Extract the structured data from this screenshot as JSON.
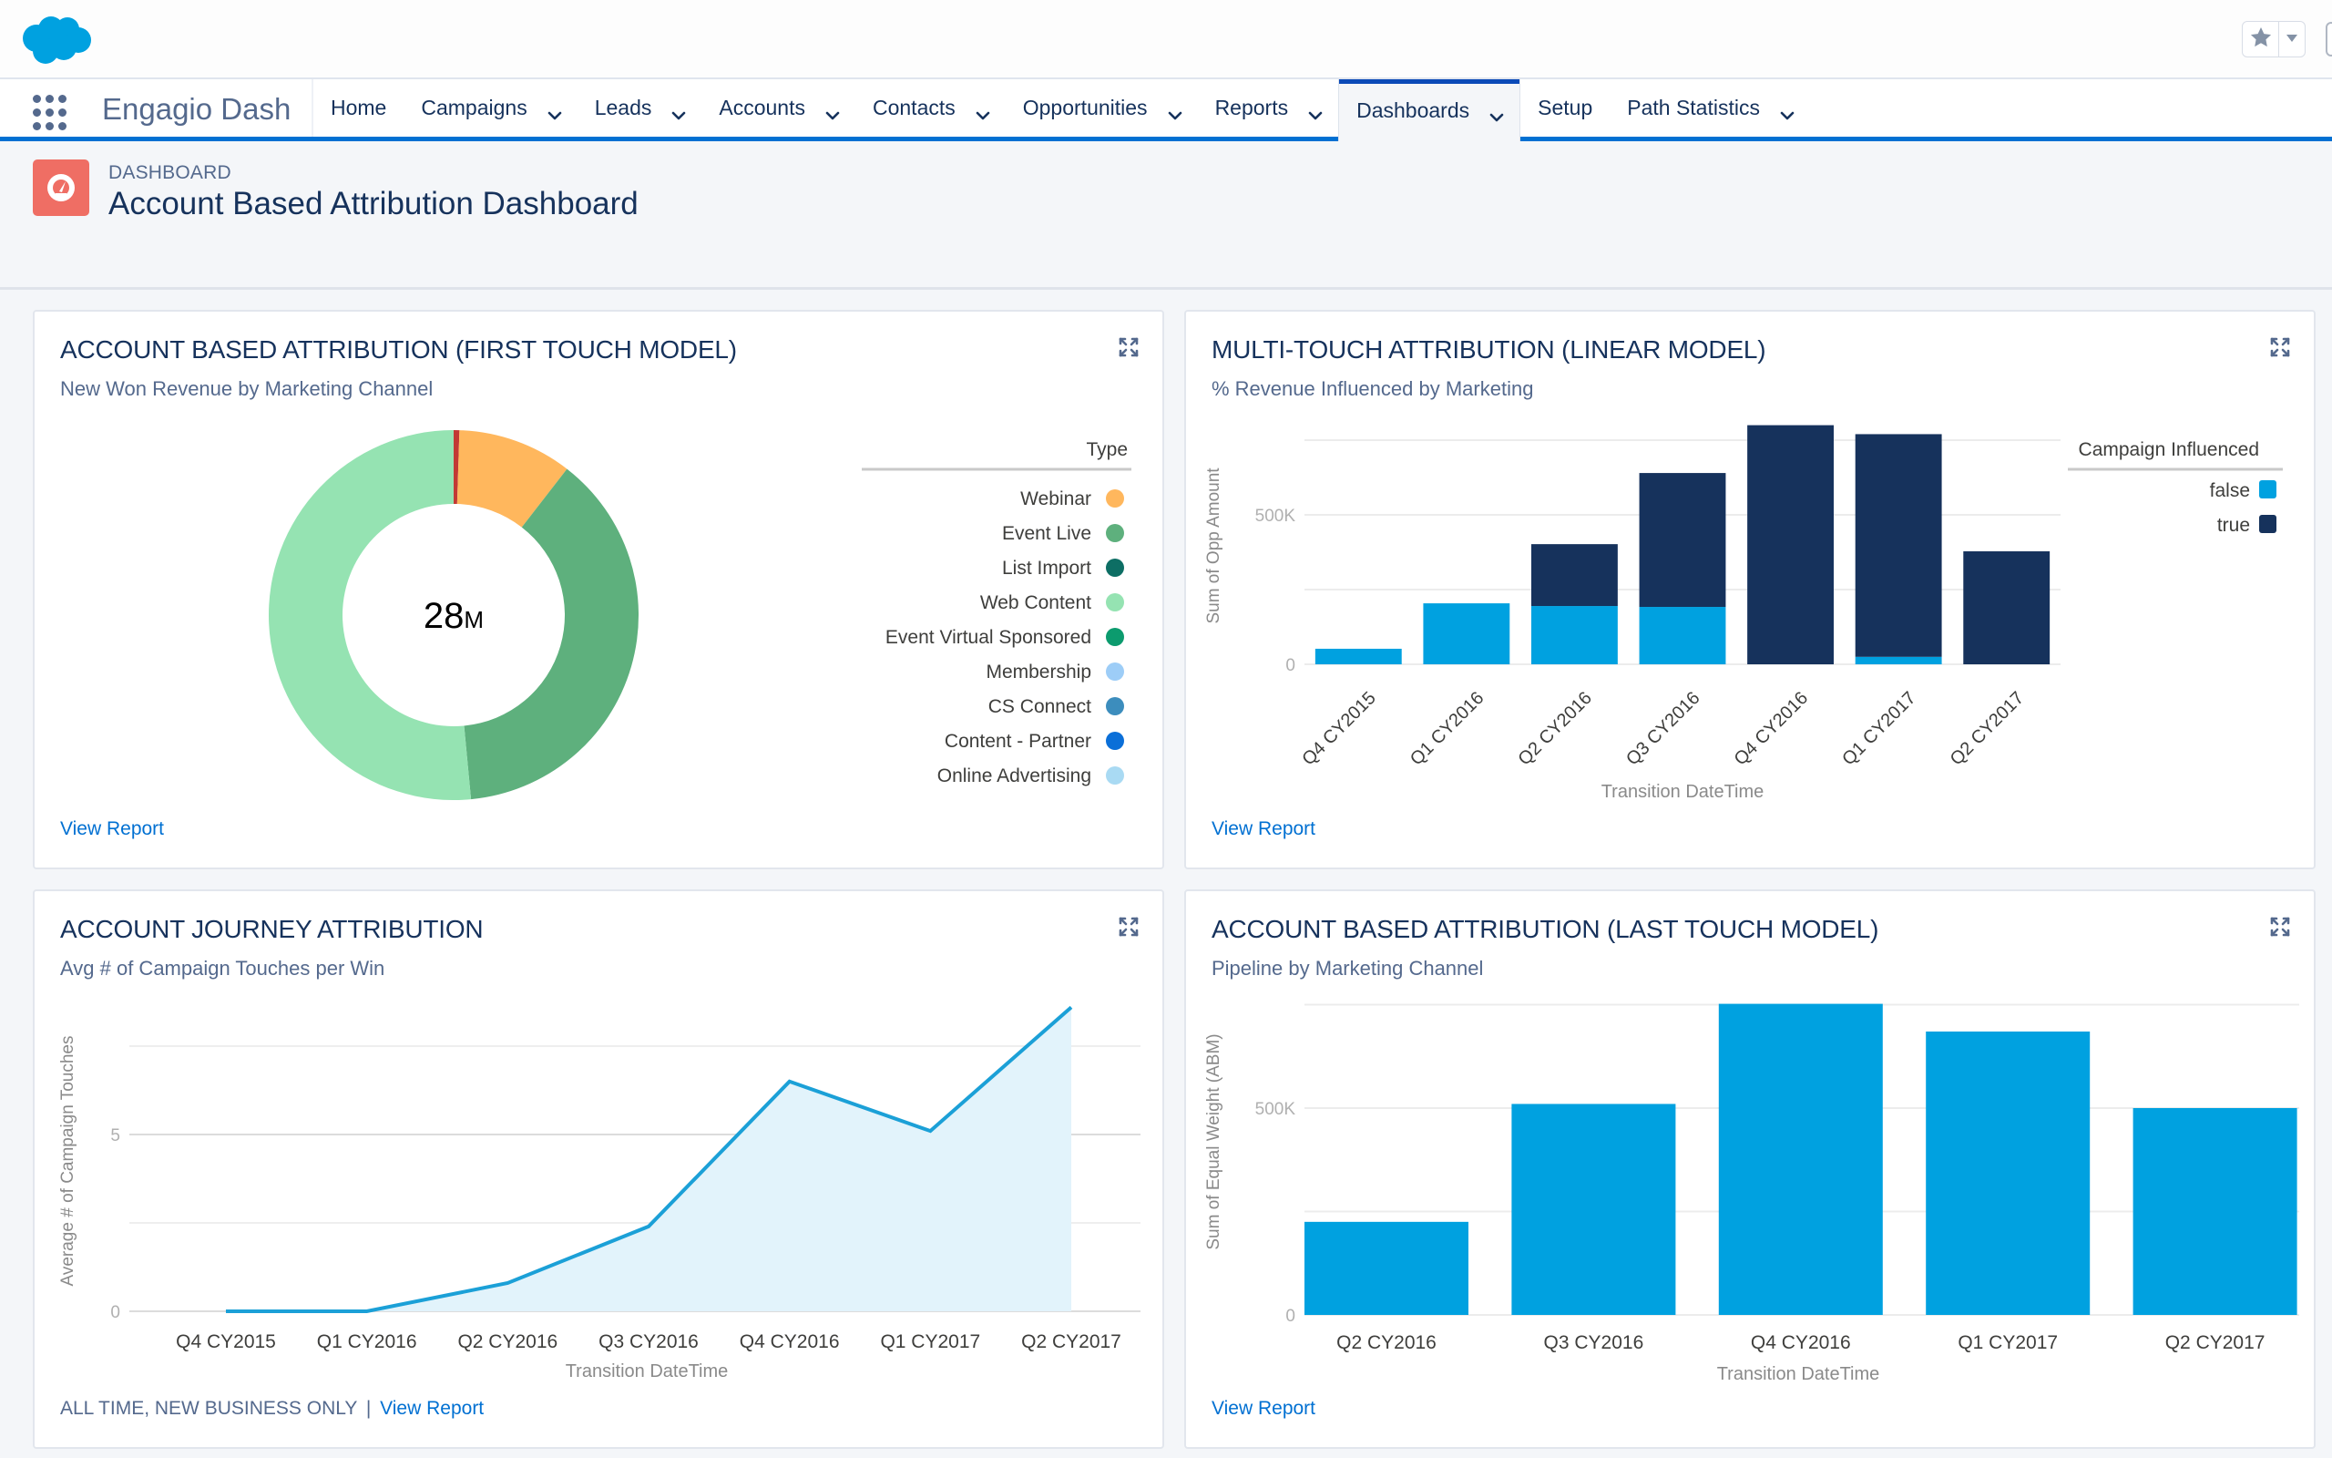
{
  "header": {
    "logo_icon": "salesforce-cloud-logo",
    "favorites_icon": "star-icon",
    "favorites_menu_icon": "caret-down-icon"
  },
  "nav": {
    "launcher_icon": "app-launcher-grid-icon",
    "app_name": "Engagio Dash",
    "items": [
      {
        "label": "Home",
        "has_menu": false,
        "active": false
      },
      {
        "label": "Campaigns",
        "has_menu": true,
        "active": false
      },
      {
        "label": "Leads",
        "has_menu": true,
        "active": false
      },
      {
        "label": "Accounts",
        "has_menu": true,
        "active": false
      },
      {
        "label": "Contacts",
        "has_menu": true,
        "active": false
      },
      {
        "label": "Opportunities",
        "has_menu": true,
        "active": false
      },
      {
        "label": "Reports",
        "has_menu": true,
        "active": false
      },
      {
        "label": "Dashboards",
        "has_menu": true,
        "active": true
      },
      {
        "label": "Setup",
        "has_menu": false,
        "active": false
      },
      {
        "label": "Path Statistics",
        "has_menu": true,
        "active": false
      }
    ]
  },
  "page": {
    "icon": "dashboard-gauge-icon",
    "type_label": "DASHBOARD",
    "title": "Account Based Attribution Dashboard"
  },
  "colors": {
    "brand_blue": "#0070d2",
    "bar_false": "#00a1e0",
    "bar_true": "#16325c",
    "line": "#1ba0d7",
    "line_fill": "#e2f3fb",
    "page_icon": "#ef6e64"
  },
  "cards": {
    "first_touch": {
      "title": "ACCOUNT BASED ATTRIBUTION (FIRST TOUCH MODEL)",
      "subtitle": "New Won Revenue by Marketing Channel",
      "footer_link": "View Report",
      "center_label": "28",
      "center_unit": "M",
      "legend_title": "Type"
    },
    "multi_touch": {
      "title": "MULTI-TOUCH ATTRIBUTION (LINEAR MODEL)",
      "subtitle": "% Revenue Influenced by Marketing",
      "footer_link": "View Report",
      "legend_title": "Campaign Influenced"
    },
    "journey": {
      "title": "ACCOUNT JOURNEY ATTRIBUTION",
      "subtitle": "Avg # of Campaign Touches per Win",
      "footer_text": "ALL TIME, NEW BUSINESS ONLY",
      "footer_sep": "|",
      "footer_link": "View Report"
    },
    "last_touch": {
      "title": "ACCOUNT BASED ATTRIBUTION (LAST TOUCH MODEL)",
      "subtitle": "Pipeline by Marketing Channel",
      "footer_link": "View Report"
    }
  },
  "chart_data": [
    {
      "id": "first_touch",
      "type": "pie",
      "variant": "donut",
      "title": "New Won Revenue by Marketing Channel",
      "total_label": "28M",
      "legend_title": "Type",
      "legend_position": "right",
      "legend": [
        {
          "label": "Webinar",
          "color": "#ffb75d"
        },
        {
          "label": "Event Live",
          "color": "#5eb07d"
        },
        {
          "label": "List Import",
          "color": "#0d6e64"
        },
        {
          "label": "Web Content",
          "color": "#95e3b2"
        },
        {
          "label": "Event Virtual Sponsored",
          "color": "#0c9b6e"
        },
        {
          "label": "Membership",
          "color": "#9dcdf7"
        },
        {
          "label": "CS Connect",
          "color": "#3c8dbd"
        },
        {
          "label": "Content - Partner",
          "color": "#0b6fd8"
        },
        {
          "label": "Online Advertising",
          "color": "#a9daf3"
        }
      ],
      "slices": [
        {
          "label": "(unlabeled)",
          "value_pct": 0.5,
          "color": "#c23934"
        },
        {
          "label": "Webinar",
          "value_pct": 10.0,
          "color": "#ffb75d"
        },
        {
          "label": "Event Live",
          "value_pct": 38.0,
          "color": "#5eb07d"
        },
        {
          "label": "Web Content",
          "value_pct": 51.5,
          "color": "#95e3b2"
        }
      ]
    },
    {
      "id": "multi_touch",
      "type": "bar",
      "stacked": true,
      "title": "% Revenue Influenced by Marketing",
      "xlabel": "Transition DateTime",
      "ylabel": "Sum of Opp Amount",
      "categories": [
        "Q4 CY2015",
        "Q1 CY2016",
        "Q2 CY2016",
        "Q3 CY2016",
        "Q4 CY2016",
        "Q1 CY2017",
        "Q2 CY2017"
      ],
      "series": [
        {
          "name": "false",
          "color": "#00a1e0",
          "values": [
            52000,
            204000,
            195000,
            192000,
            0,
            25000,
            0
          ]
        },
        {
          "name": "true",
          "color": "#16325c",
          "values": [
            0,
            0,
            207000,
            448000,
            800000,
            745000,
            378000
          ]
        }
      ],
      "ylim": [
        0,
        800000
      ],
      "yticks": [
        {
          "value": 0,
          "label": "0"
        },
        {
          "value": 500000,
          "label": "500K"
        }
      ],
      "gridlines": [
        0,
        250000,
        500000,
        750000
      ],
      "legend_title": "Campaign Influenced",
      "legend_position": "right",
      "x_tick_rotation": "diagonal"
    },
    {
      "id": "journey",
      "type": "area",
      "title": "Avg # of Campaign Touches per Win",
      "xlabel": "Transition DateTime",
      "ylabel": "Average # of Campaign Touches",
      "categories": [
        "Q4 CY2015",
        "Q1 CY2016",
        "Q2 CY2016",
        "Q3 CY2016",
        "Q4 CY2016",
        "Q1 CY2017",
        "Q2 CY2017"
      ],
      "values": [
        0,
        0,
        0.8,
        2.4,
        6.5,
        5.1,
        8.6
      ],
      "ylim": [
        0,
        8.8
      ],
      "yticks": [
        {
          "value": 0,
          "label": "0"
        },
        {
          "value": 5,
          "label": "5"
        }
      ],
      "gridlines": [
        0,
        2.5,
        5,
        7.5
      ],
      "grid": true
    },
    {
      "id": "last_touch",
      "type": "bar",
      "title": "Pipeline by Marketing Channel",
      "xlabel": "Transition DateTime",
      "ylabel": "Sum of Equal Weight (ABM)",
      "categories": [
        "Q2 CY2016",
        "Q3 CY2016",
        "Q4 CY2016",
        "Q1 CY2017",
        "Q2 CY2017"
      ],
      "values": [
        225000,
        510000,
        752000,
        685000,
        500000
      ],
      "color": "#00a1e0",
      "ylim": [
        0,
        752000
      ],
      "yticks": [
        {
          "value": 0,
          "label": "0"
        },
        {
          "value": 500000,
          "label": "500K"
        }
      ],
      "gridlines": [
        0,
        250000,
        500000,
        750000
      ]
    }
  ]
}
